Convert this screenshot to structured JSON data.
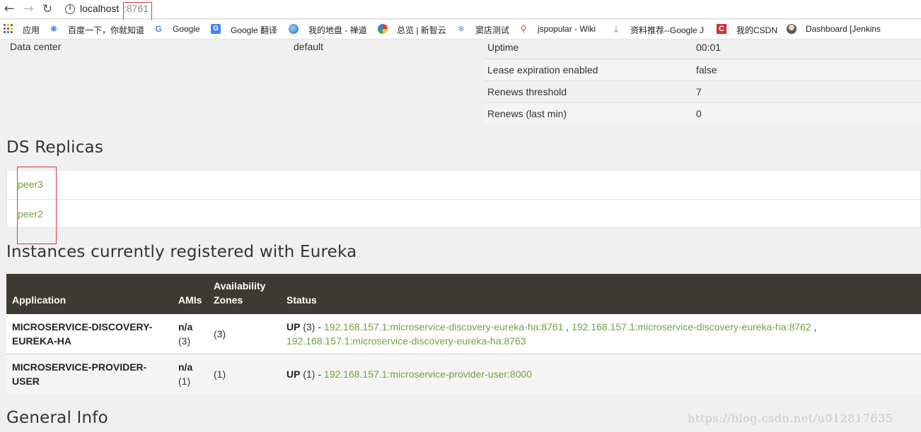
{
  "browser": {
    "url_host": "localhost",
    "url_port": ":8761",
    "bookmarks": [
      {
        "label": "应用",
        "icon": "apps-icon"
      },
      {
        "label": "百度一下，你就知道",
        "icon": "baidu-paw-icon"
      },
      {
        "label": "Google",
        "icon": "google-g-icon"
      },
      {
        "label": "Google 翻译",
        "icon": "google-translate-icon"
      },
      {
        "label": "我的地盘 - 禅道",
        "icon": "zentao-globe-icon"
      },
      {
        "label": "总览 | 新智云",
        "icon": "xinzhiyun-icon"
      },
      {
        "label": "窦店测试",
        "icon": "snowflake-icon"
      },
      {
        "label": "jspopular - Wiki",
        "icon": "map-pin-icon"
      },
      {
        "label": "资料推荐--Google J",
        "icon": "knife-fork-icon"
      },
      {
        "label": "我的CSDN",
        "icon": "csdn-icon"
      },
      {
        "label": "Dashboard [Jenkins",
        "icon": "jenkins-icon"
      }
    ]
  },
  "env": {
    "data_center_label": "Data center",
    "data_center_value": "default"
  },
  "stats": [
    {
      "key": "Uptime",
      "value": "00:01"
    },
    {
      "key": "Lease expiration enabled",
      "value": "false"
    },
    {
      "key": "Renews threshold",
      "value": "7"
    },
    {
      "key": "Renews (last min)",
      "value": "0"
    }
  ],
  "ds_replicas": {
    "title": "DS Replicas",
    "items": [
      "peer3",
      "peer2"
    ]
  },
  "instances": {
    "title": "Instances currently registered with Eureka",
    "headers": {
      "application": "Application",
      "amis": "AMIs",
      "zones_line1": "Availability",
      "zones_line2": "Zones",
      "status": "Status"
    },
    "rows": [
      {
        "app_line1": "MICROSERVICE-DISCOVERY-",
        "app_line2": "EUREKA-HA",
        "amis_line1": "n/a",
        "amis_line2": "(3)",
        "zones": "(3)",
        "status_state": "UP",
        "status_count": " (3) - ",
        "links": [
          "192.168.157.1:microservice-discovery-eureka-ha:8761",
          "192.168.157.1:microservice-discovery-eureka-ha:8762",
          "192.168.157.1:microservice-discovery-eureka-ha:8763"
        ]
      },
      {
        "app_line1": "MICROSERVICE-PROVIDER-",
        "app_line2": "USER",
        "amis_line1": "n/a",
        "amis_line2": "(1)",
        "zones": "(1)",
        "status_state": "UP",
        "status_count": " (1) - ",
        "links": [
          "192.168.157.1:microservice-provider-user:8000"
        ]
      }
    ]
  },
  "general_info": {
    "title": "General Info"
  },
  "watermark": "https://blog.csdn.net/u012817635",
  "colors": {
    "link": "#6da33f",
    "table_header": "#3d3a33",
    "highlight_box": "#d83a3a"
  }
}
